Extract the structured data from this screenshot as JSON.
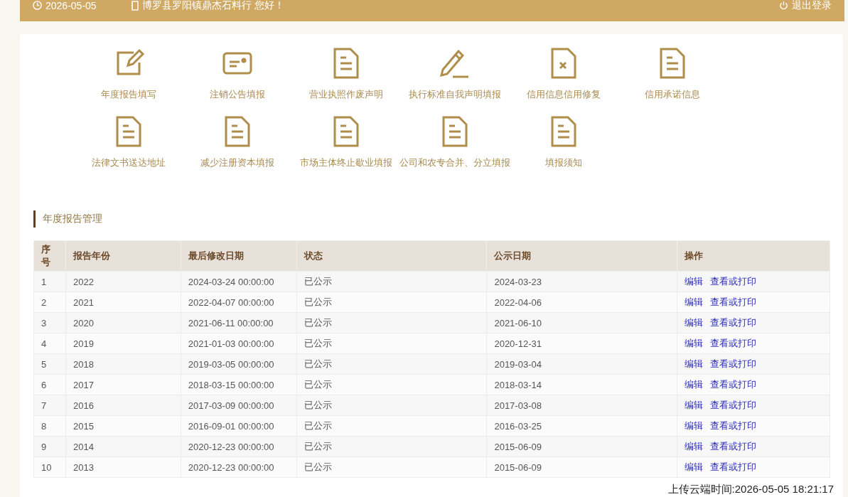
{
  "top_bar": {
    "date": "2026-05-05",
    "greeting": "博罗县罗阳镇鼎杰石料行 您好！",
    "logout": "退出登录"
  },
  "shortcuts": [
    {
      "label": "年度报告填写",
      "kind": "edit"
    },
    {
      "label": "注销公告填报",
      "kind": "card"
    },
    {
      "label": "营业执照作废声明",
      "kind": "doc"
    },
    {
      "label": "执行标准自我声明填报",
      "kind": "pencil"
    },
    {
      "label": "信用信息信用修复",
      "kind": "doc-x"
    },
    {
      "label": "信用承诺信息",
      "kind": "doc"
    },
    {
      "label": "法律文书送达地址",
      "kind": "doc"
    },
    {
      "label": "减少注册资本填报",
      "kind": "doc"
    },
    {
      "label": "市场主体终止歇业填报",
      "kind": "doc"
    },
    {
      "label": "公司和农专合并、分立填报",
      "kind": "doc"
    },
    {
      "label": "填报须知",
      "kind": "doc"
    }
  ],
  "section_title": "年度报告管理",
  "table": {
    "columns": [
      "序号",
      "报告年份",
      "最后修改日期",
      "状态",
      "公示日期",
      "操作"
    ],
    "rows": [
      {
        "cells": [
          "1",
          "2022",
          "2024-03-24 00:00:00",
          "已公示",
          "2024-03-23"
        ],
        "actions": [
          "编辑",
          "查看或打印"
        ]
      },
      {
        "cells": [
          "2",
          "2021",
          "2022-04-07 00:00:00",
          "已公示",
          "2022-04-06"
        ],
        "actions": [
          "编辑",
          "查看或打印"
        ]
      },
      {
        "cells": [
          "3",
          "2020",
          "2021-06-11 00:00:00",
          "已公示",
          "2021-06-10"
        ],
        "actions": [
          "编辑",
          "查看或打印"
        ]
      },
      {
        "cells": [
          "4",
          "2019",
          "2021-01-03 00:00:00",
          "已公示",
          "2020-12-31"
        ],
        "actions": [
          "编辑",
          "查看或打印"
        ]
      },
      {
        "cells": [
          "5",
          "2018",
          "2019-03-05 00:00:00",
          "已公示",
          "2019-03-04"
        ],
        "actions": [
          "编辑",
          "查看或打印"
        ]
      },
      {
        "cells": [
          "6",
          "2017",
          "2018-03-15 00:00:00",
          "已公示",
          "2018-03-14"
        ],
        "actions": [
          "编辑",
          "查看或打印"
        ]
      },
      {
        "cells": [
          "7",
          "2016",
          "2017-03-09 00:00:00",
          "已公示",
          "2017-03-08"
        ],
        "actions": [
          "编辑",
          "查看或打印"
        ]
      },
      {
        "cells": [
          "8",
          "2015",
          "2016-09-01 00:00:00",
          "已公示",
          "2016-03-25"
        ],
        "actions": [
          "编辑",
          "查看或打印"
        ]
      },
      {
        "cells": [
          "9",
          "2014",
          "2020-12-23 00:00:00",
          "已公示",
          "2015-06-09"
        ],
        "actions": [
          "编辑",
          "查看或打印"
        ]
      },
      {
        "cells": [
          "10",
          "2013",
          "2020-12-23 00:00:00",
          "已公示",
          "2015-06-09"
        ],
        "actions": [
          "编辑",
          "查看或打印"
        ]
      }
    ]
  },
  "upload_stamp": "上传云端时间:2026-05-05 18:21:17"
}
